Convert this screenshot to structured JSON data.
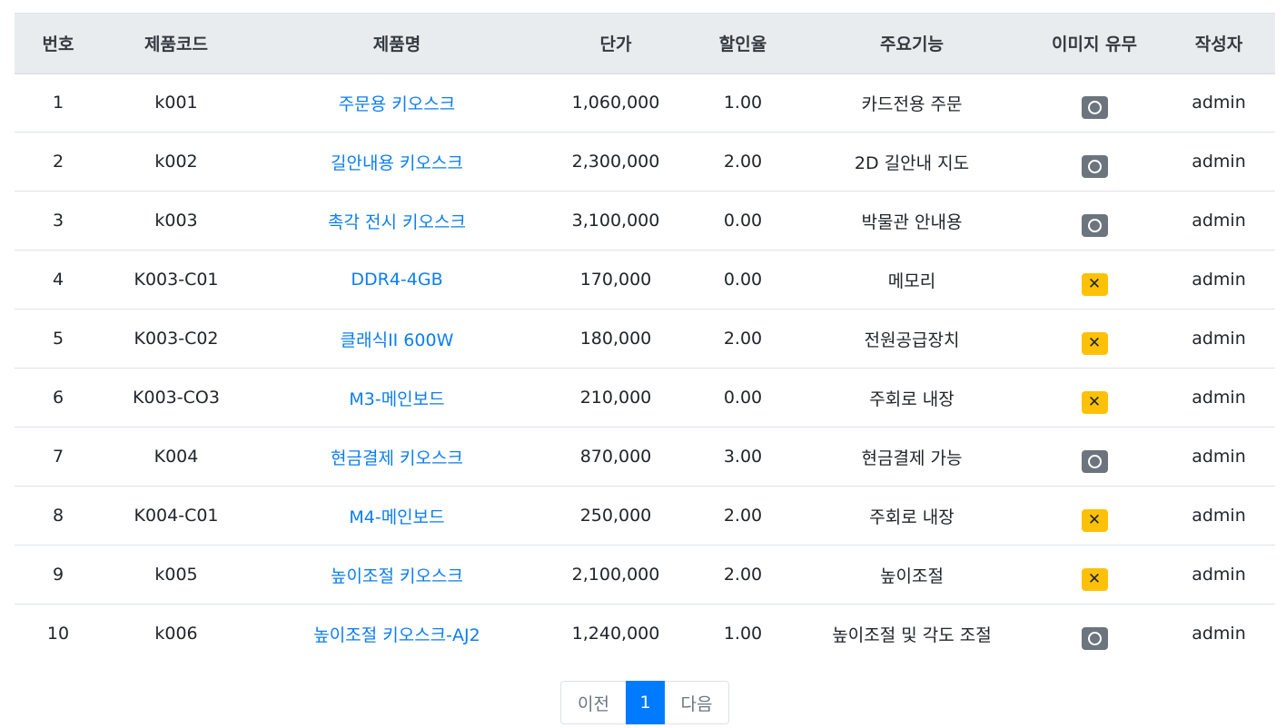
{
  "table": {
    "headers": [
      "번호",
      "제품코드",
      "제품명",
      "단가",
      "할인율",
      "주요기능",
      "이미지 유무",
      "작성자"
    ],
    "rows": [
      {
        "no": "1",
        "code": "k001",
        "name": "주문용 키오스크",
        "price": "1,060,000",
        "discount": "1.00",
        "feature": "카드전용 주문",
        "has_image": true,
        "author": "admin"
      },
      {
        "no": "2",
        "code": "k002",
        "name": "길안내용 키오스크",
        "price": "2,300,000",
        "discount": "2.00",
        "feature": "2D 길안내 지도",
        "has_image": true,
        "author": "admin"
      },
      {
        "no": "3",
        "code": "k003",
        "name": "촉각 전시 키오스크",
        "price": "3,100,000",
        "discount": "0.00",
        "feature": "박물관 안내용",
        "has_image": true,
        "author": "admin"
      },
      {
        "no": "4",
        "code": "K003-C01",
        "name": "DDR4-4GB",
        "price": "170,000",
        "discount": "0.00",
        "feature": "메모리",
        "has_image": false,
        "author": "admin"
      },
      {
        "no": "5",
        "code": "K003-C02",
        "name": "클래식II 600W",
        "price": "180,000",
        "discount": "2.00",
        "feature": "전원공급장치",
        "has_image": false,
        "author": "admin"
      },
      {
        "no": "6",
        "code": "K003-CO3",
        "name": "M3-메인보드",
        "price": "210,000",
        "discount": "0.00",
        "feature": "주회로 내장",
        "has_image": false,
        "author": "admin"
      },
      {
        "no": "7",
        "code": "K004",
        "name": "현금결제 키오스크",
        "price": "870,000",
        "discount": "3.00",
        "feature": "현금결제 가능",
        "has_image": true,
        "author": "admin"
      },
      {
        "no": "8",
        "code": "K004-C01",
        "name": "M4-메인보드",
        "price": "250,000",
        "discount": "2.00",
        "feature": "주회로 내장",
        "has_image": false,
        "author": "admin"
      },
      {
        "no": "9",
        "code": "k005",
        "name": "높이조절 키오스크",
        "price": "2,100,000",
        "discount": "2.00",
        "feature": "높이조절",
        "has_image": false,
        "author": "admin"
      },
      {
        "no": "10",
        "code": "k006",
        "name": "높이조절 키오스크-AJ2",
        "price": "1,240,000",
        "discount": "1.00",
        "feature": "높이조절 및 각도 조절",
        "has_image": true,
        "author": "admin"
      }
    ]
  },
  "pagination": {
    "prev_label": "이전",
    "current_page": "1",
    "next_label": "다음"
  },
  "icons": {
    "image_present": "circle-icon",
    "image_absent": "x-icon"
  },
  "colors": {
    "link": "#0d7ef0",
    "image_present_badge": "#6c757d",
    "image_absent_badge": "#ffc107",
    "active_page": "#007bff",
    "header_bg": "#e9ecef"
  }
}
